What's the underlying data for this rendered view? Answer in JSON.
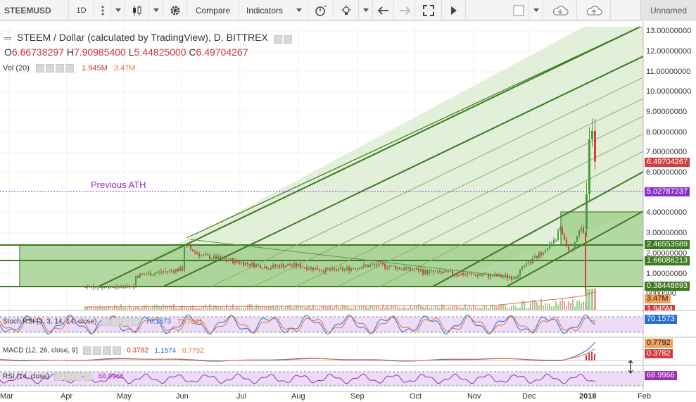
{
  "toolbar": {
    "symbol": "STEEMUSD",
    "interval": "1D",
    "compare_label": "Compare",
    "indicators_label": "Indicators",
    "layout_name": "Unnamed"
  },
  "legend": {
    "title": "STEEM / Dollar (calculated by TradingView), D, BITTREX",
    "o_label": "O",
    "o_value": "6.66738297",
    "h_label": "H",
    "h_value": "7.90985400",
    "l_label": "L",
    "l_value": "5.44825000",
    "c_label": "C",
    "c_value": "6.49704267"
  },
  "volume": {
    "label": "Vol (20)",
    "v1": "1.945M",
    "v2": "3.47M"
  },
  "stoch": {
    "label": "Stoch RSI (3, 3, 14, 14, close)",
    "v1": "70.1573",
    "v2": "78.7641"
  },
  "macd": {
    "label": "MACD (12, 26, close, 9)",
    "v1": "0.3782",
    "v2": "1.1574",
    "v3": "0.7792"
  },
  "rsi": {
    "label": "RSI (14, close)",
    "v1": "68.9966"
  },
  "annotation": "Previous ATH",
  "price_axis": [
    "13.00000000",
    "12.00000000",
    "11.00000000",
    "10.00000000",
    "9.00000000",
    "8.00000000",
    "7.00000000",
    "6.00000000",
    "4.00000000",
    "3.00000000",
    "2.00000000",
    "1.00000000"
  ],
  "tags": {
    "last_price": "6.49704267",
    "ath": "5.02787237",
    "level1": "2.46553589",
    "level2": "1.66086213",
    "level3": "0.38448693",
    "vol_a": "3.47M",
    "vol_b": "1.945M",
    "stoch_val": "70.1573",
    "macd_a": "0.7792",
    "macd_b": "0.3782",
    "rsi_val": "68.9966",
    "zero_label": "0000000"
  },
  "time_axis": [
    "Mar",
    "Apr",
    "May",
    "Jun",
    "Jul",
    "Aug",
    "Sep",
    "Oct",
    "Nov",
    "Dec",
    "2018",
    "Feb"
  ],
  "colors": {
    "accent_green": "#3b7a1e",
    "fill_green": "#b9dca7",
    "ath_purple": "#8b2fc9",
    "down_red": "#d23f3f",
    "up_green": "#4a9a3b"
  }
}
